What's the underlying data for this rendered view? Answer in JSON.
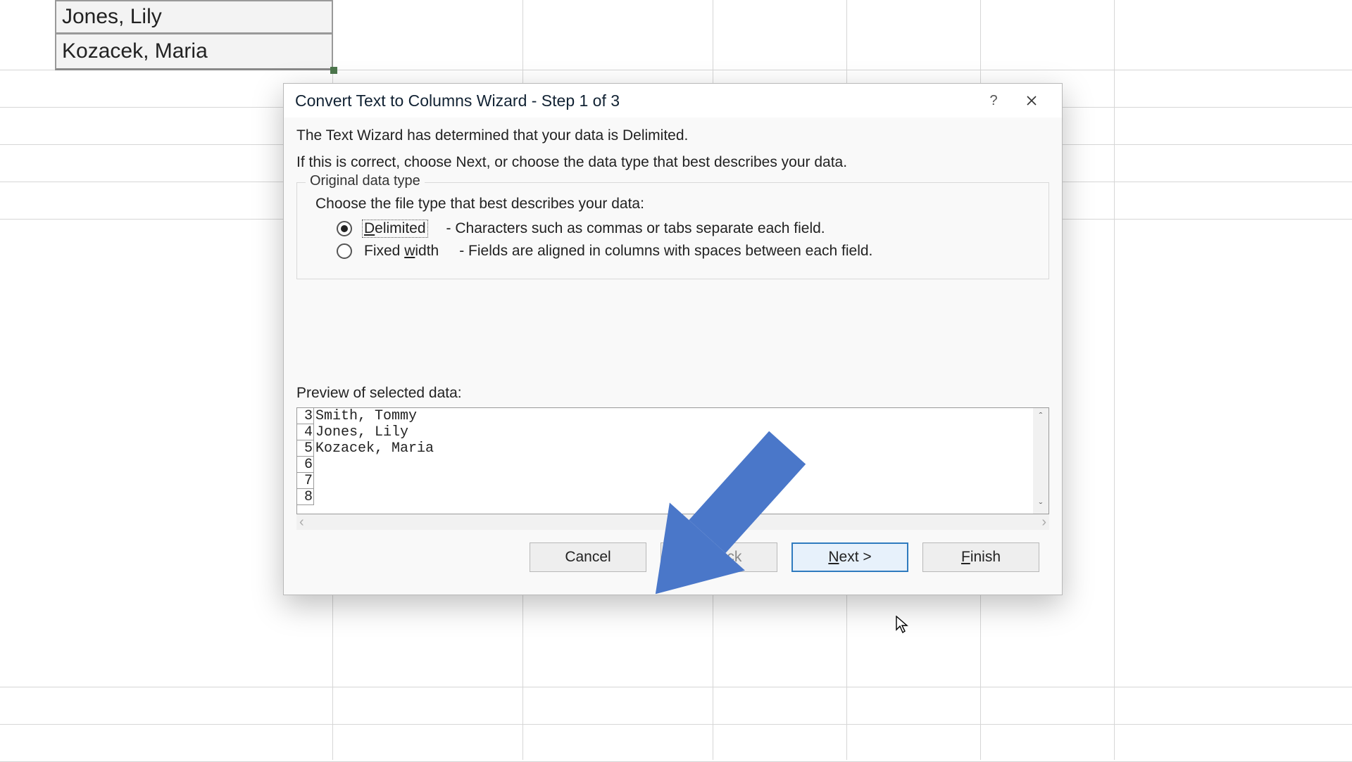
{
  "sheet": {
    "cells": [
      "Jones, Lily",
      "Kozacek, Maria"
    ]
  },
  "dialog": {
    "title": "Convert Text to Columns Wizard - Step 1 of 3",
    "intro1": "The Text Wizard has determined that your data is Delimited.",
    "intro2": "If this is correct, choose Next, or choose the data type that best describes your data.",
    "fieldset_title": "Original data type",
    "fieldset_sub": "Choose the file type that best describes your data:",
    "opt_delimited": "Delimited",
    "opt_delimited_desc": "- Characters such as commas or tabs separate each field.",
    "opt_fixed": "Fixed width",
    "opt_fixed_desc": "- Fields are aligned in columns with spaces between each field.",
    "preview_label": "Preview of selected data:",
    "preview_rows": [
      {
        "n": "3",
        "t": "Smith, Tommy"
      },
      {
        "n": "4",
        "t": "Jones, Lily"
      },
      {
        "n": "5",
        "t": "Kozacek, Maria"
      },
      {
        "n": "6",
        "t": ""
      },
      {
        "n": "7",
        "t": ""
      },
      {
        "n": "8",
        "t": ""
      }
    ],
    "buttons": {
      "cancel": "Cancel",
      "back": "< Back",
      "next": "Next >",
      "finish": "Finish"
    }
  }
}
